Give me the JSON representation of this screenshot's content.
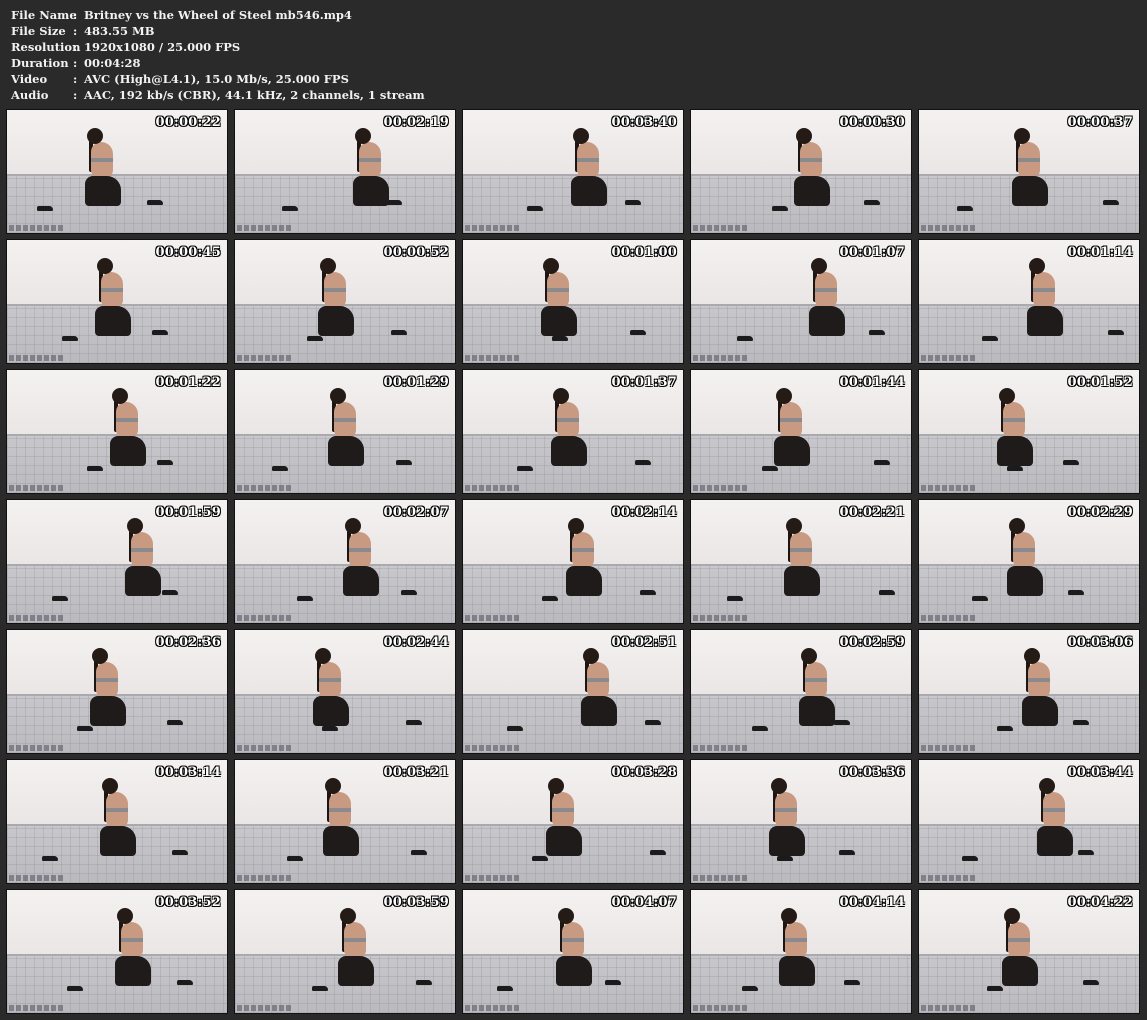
{
  "info": [
    {
      "label": "File Name",
      "sep": ":",
      "value": "Britney vs the Wheel of Steel mb546.mp4"
    },
    {
      "label": "File Size",
      "sep": ":",
      "value": "483.55 MB"
    },
    {
      "label": "Resolution",
      "sep": ":",
      "value": "1920x1080 / 25.000 FPS"
    },
    {
      "label": "Duration",
      "sep": ":",
      "value": "00:04:28"
    },
    {
      "label": "Video",
      "sep": ":",
      "value": "AVC (High@L4.1), 15.0 Mb/s, 25.000 FPS"
    },
    {
      "label": "Audio",
      "sep": ":",
      "value": "AAC, 192 kb/s (CBR), 44.1 kHz, 2 channels, 1 stream"
    }
  ],
  "thumbnails": [
    "00:00:22",
    "00:02:19",
    "00:03:40",
    "00:00:30",
    "00:00:37",
    "00:00:45",
    "00:00:52",
    "00:01:00",
    "00:01:07",
    "00:01:14",
    "00:01:22",
    "00:01:29",
    "00:01:37",
    "00:01:44",
    "00:01:52",
    "00:01:59",
    "00:02:07",
    "00:02:14",
    "00:02:21",
    "00:02:29",
    "00:02:36",
    "00:02:44",
    "00:02:51",
    "00:02:59",
    "00:03:06",
    "00:03:14",
    "00:03:21",
    "00:03:28",
    "00:03:36",
    "00:03:44",
    "00:03:52",
    "00:03:59",
    "00:04:07",
    "00:04:14",
    "00:04:22"
  ],
  "colors": {
    "background": "#2a2a2a",
    "text": "#f2f2f2",
    "timestamp": "#ffffff"
  }
}
